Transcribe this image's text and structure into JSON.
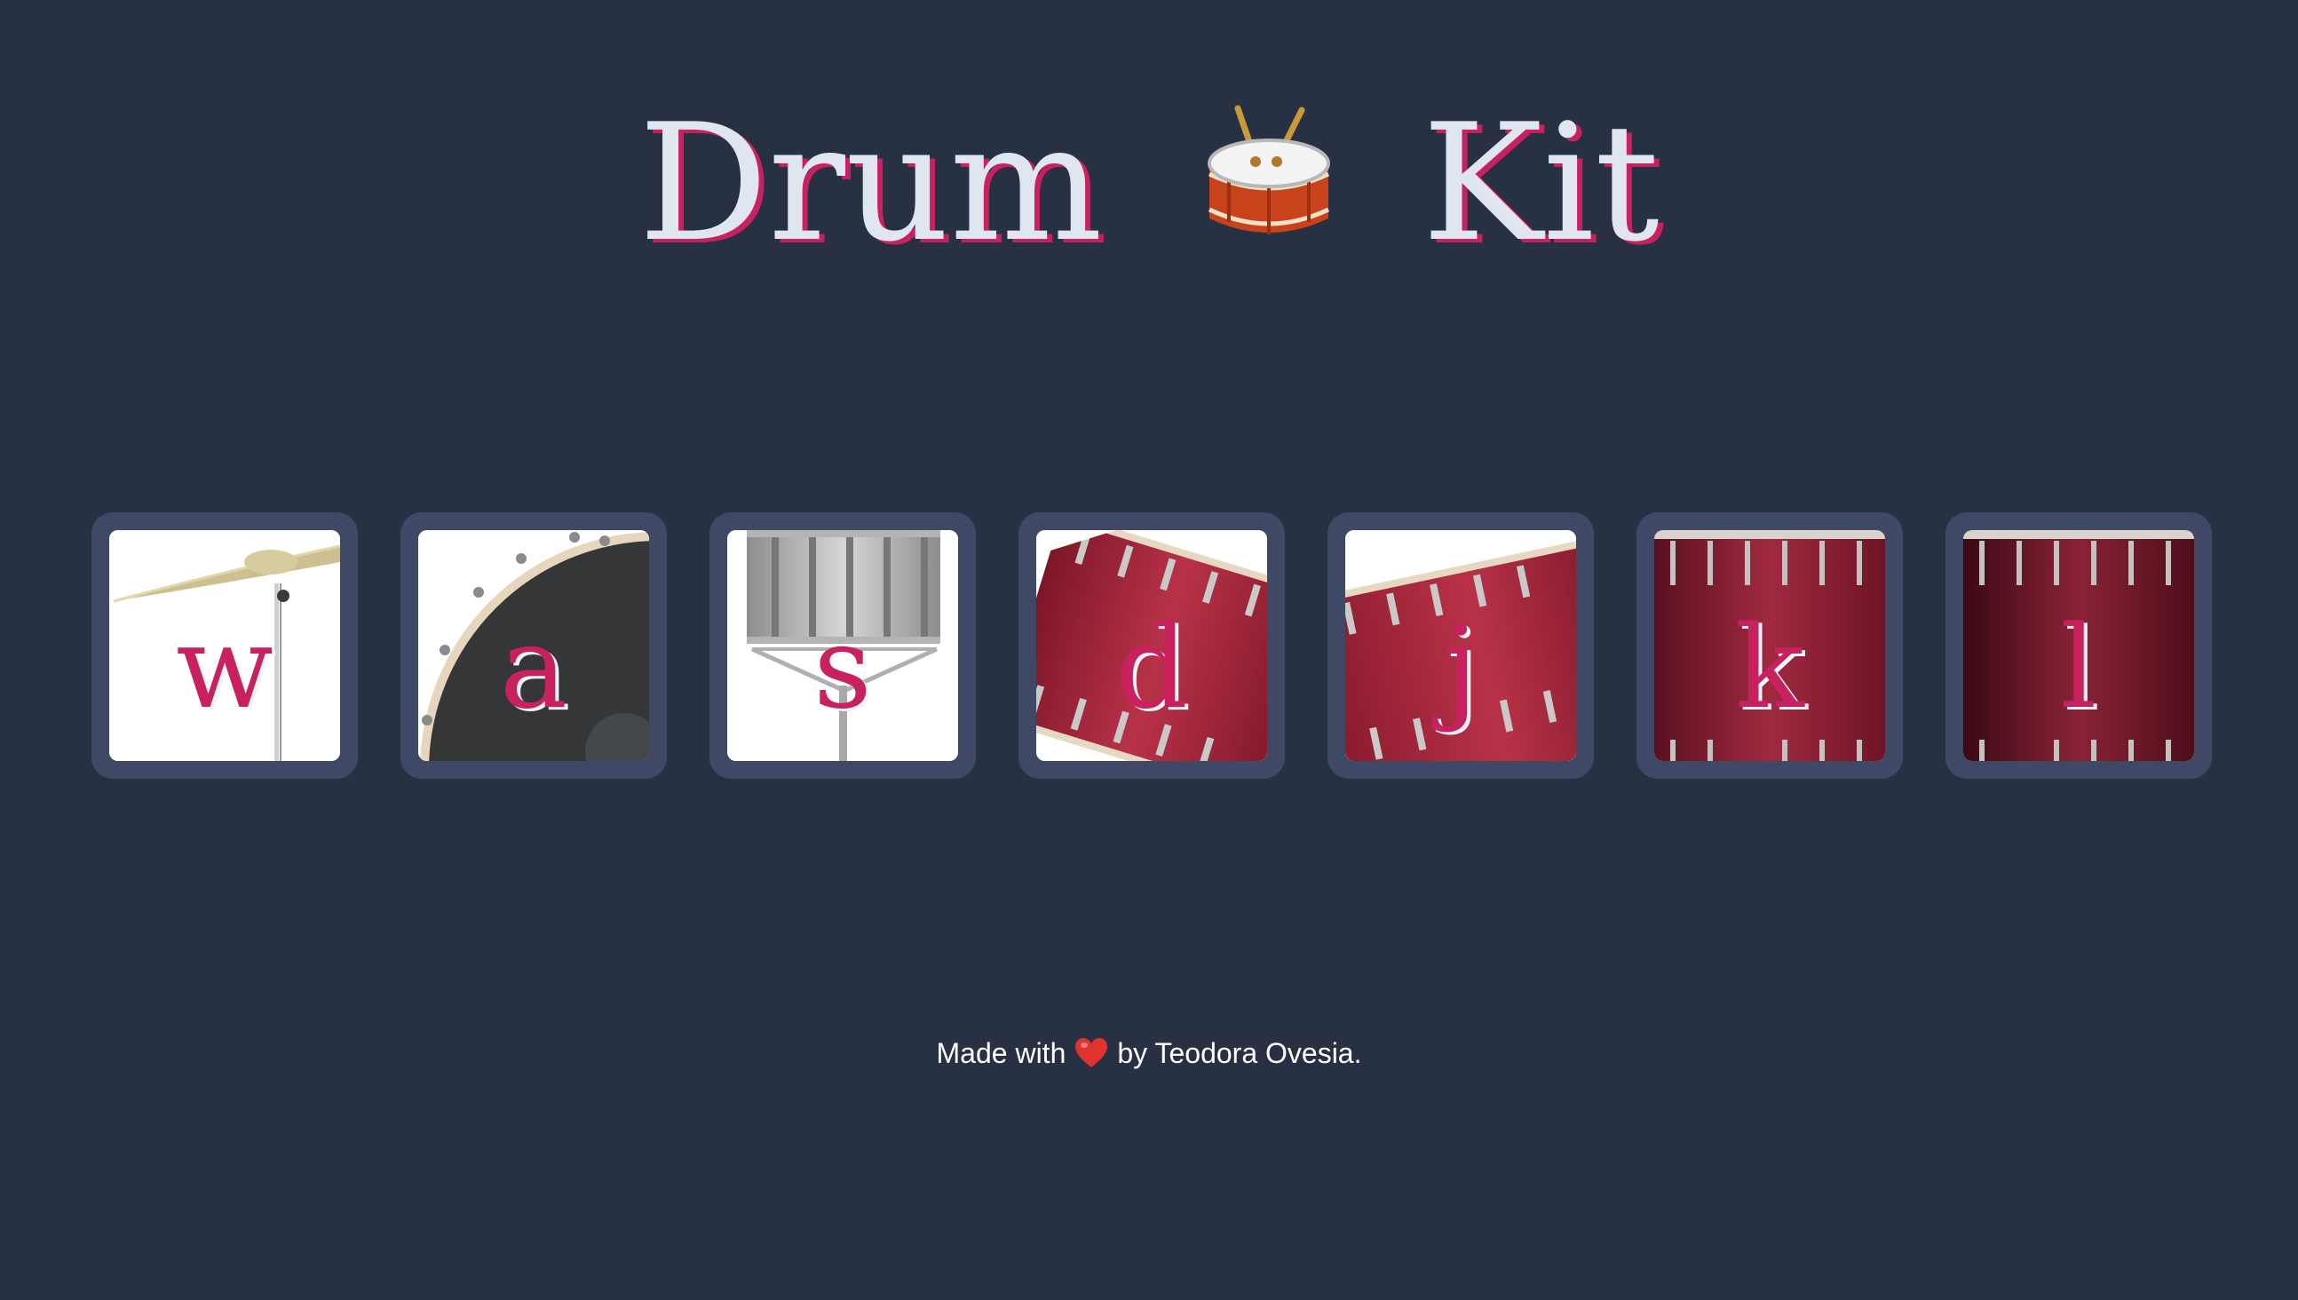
{
  "header": {
    "title_start": "Drum",
    "title_icon": "drum-icon",
    "title_end": "Kit"
  },
  "pads": [
    {
      "key": "w",
      "instrument_icon": "cymbal-icon"
    },
    {
      "key": "a",
      "instrument_icon": "bass-drum-icon"
    },
    {
      "key": "s",
      "instrument_icon": "snare-drum-icon"
    },
    {
      "key": "d",
      "instrument_icon": "tom-drum-icon"
    },
    {
      "key": "j",
      "instrument_icon": "tom-drum-icon"
    },
    {
      "key": "k",
      "instrument_icon": "floor-tom-icon"
    },
    {
      "key": "l",
      "instrument_icon": "floor-tom-icon"
    }
  ],
  "footer": {
    "made_with": "Made with",
    "heart_icon": "heart-icon",
    "by_author": "by Teodora Ovesia."
  },
  "colors": {
    "background": "#283044",
    "pad": "#3f4966",
    "accent": "#c9205f",
    "title_text": "#dfe6ef"
  }
}
